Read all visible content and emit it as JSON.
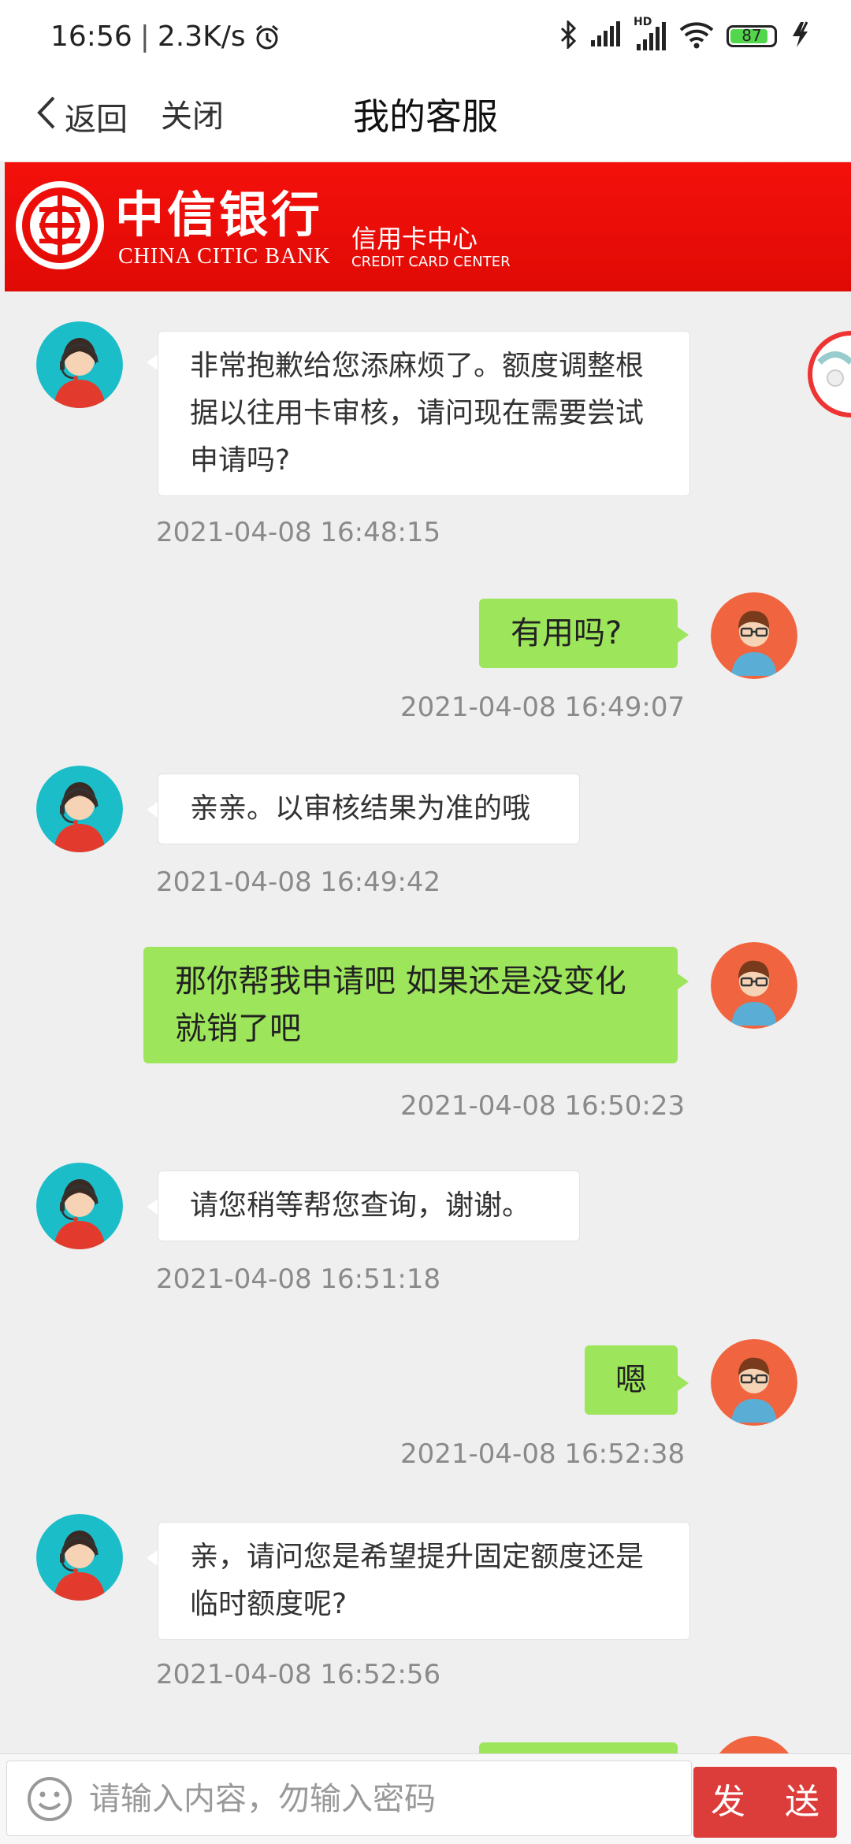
{
  "status_bar": {
    "time": "16:56",
    "speed": "2.3K/s",
    "battery_level": "87",
    "battery_percent": 87,
    "network_label": "HD"
  },
  "nav": {
    "back_label": "返回",
    "close_label": "关闭",
    "title": "我的客服"
  },
  "banner": {
    "bank_name_cn": "中信银行",
    "bank_name_en": "CHINA CITIC BANK",
    "center_cn": "信用卡中心",
    "center_en": "CREDIT CARD CENTER",
    "logo_text": "CITIC"
  },
  "messages": [
    {
      "from": "agent",
      "text": "非常抱歉给您添麻烦了。额度调整根据以往用卡审核，请问现在需要尝试申请吗?",
      "time": "2021-04-08 16:48:15"
    },
    {
      "from": "user",
      "text": "有用吗?",
      "time": "2021-04-08 16:49:07"
    },
    {
      "from": "agent",
      "text": "亲亲。以审核结果为准的哦",
      "time": "2021-04-08 16:49:42"
    },
    {
      "from": "user",
      "text": "那你帮我申请吧 如果还是没变化 就销了吧",
      "time": "2021-04-08 16:50:23"
    },
    {
      "from": "agent",
      "text": "请您稍等帮您查询，谢谢。",
      "time": "2021-04-08 16:51:18"
    },
    {
      "from": "user",
      "text": "嗯",
      "time": "2021-04-08 16:52:38"
    },
    {
      "from": "agent",
      "text": "亲，请问您是希望提升固定额度还是临时额度呢?",
      "time": "2021-04-08 16:52:56"
    }
  ],
  "input": {
    "placeholder": "请输入内容，勿输入密码",
    "send_label": "发 送"
  },
  "colors": {
    "banner_red": "#e80d07",
    "user_bubble": "#9de65b",
    "send_button": "#dc3d3a",
    "agent_avatar_bg": "#1bbec8",
    "user_avatar_bg": "#f0653f"
  }
}
